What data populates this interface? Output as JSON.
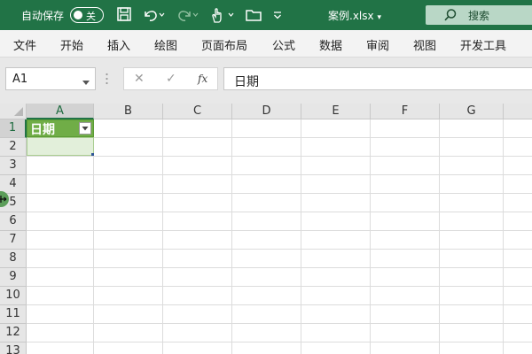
{
  "titlebar": {
    "autosave_label": "自动保存",
    "autosave_toggle": "关",
    "doc_title": "案例.xlsx",
    "search_label": "搜索",
    "icons": [
      "save-icon",
      "undo-icon",
      "redo-icon",
      "touch-mode-icon",
      "open-folder-icon",
      "customize-toolbar-icon"
    ]
  },
  "ribbon": {
    "tabs": [
      "文件",
      "开始",
      "插入",
      "绘图",
      "页面布局",
      "公式",
      "数据",
      "审阅",
      "视图",
      "开发工具"
    ]
  },
  "formula_bar": {
    "name_box": "A1",
    "cancel": "✕",
    "enter": "✓",
    "fx": "fx",
    "formula": "日期"
  },
  "sheet": {
    "columns": [
      "A",
      "B",
      "C",
      "D",
      "E",
      "F",
      "G"
    ],
    "rows": [
      "1",
      "2",
      "3",
      "4",
      "5",
      "6",
      "7",
      "8",
      "9",
      "10",
      "11",
      "12",
      "13"
    ],
    "active_cell": "A1",
    "cells": {
      "A1": "日期"
    },
    "colors": {
      "header_fill": "#70ad47",
      "selected_fill": "#e2efda",
      "brand": "#217346"
    }
  }
}
